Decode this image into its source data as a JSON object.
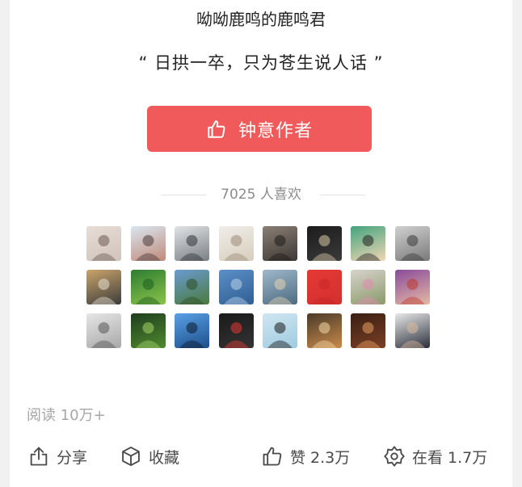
{
  "author_name": "呦呦鹿鸣的鹿鸣君",
  "motto": "“ 日拱一卒，只为苍生说人话 ”",
  "favorite_button": {
    "label": "钟意作者"
  },
  "likes": {
    "count_text": "7025 人喜欢"
  },
  "avatars": [
    {
      "icon": "cat-photo",
      "c1": "#e8ddd6",
      "c2": "#cfc3bb",
      "accent": "#6b5a52"
    },
    {
      "icon": "person-photo",
      "c1": "#d9e6f0",
      "c2": "#c18a7a",
      "accent": "#4a3a3a"
    },
    {
      "icon": "landscape-photo",
      "c1": "#e1e4e6",
      "c2": "#7a7f84",
      "accent": "#2f3336"
    },
    {
      "icon": "figure-photo",
      "c1": "#f0eee9",
      "c2": "#d8cdbd",
      "accent": "#9c8b78"
    },
    {
      "icon": "dark-photo",
      "c1": "#8a7f75",
      "c2": "#3d3833",
      "accent": "#1e1b19"
    },
    {
      "icon": "piano-photo",
      "c1": "#1c1c1c",
      "c2": "#3a3a3a",
      "accent": "#d9c9a8"
    },
    {
      "icon": "cartoon-avatar",
      "c1": "#43a37d",
      "c2": "#f2d6b5",
      "accent": "#222222"
    },
    {
      "icon": "bw-photo",
      "c1": "#d0d0d0",
      "c2": "#7a7a7a",
      "accent": "#3a3a3a"
    },
    {
      "icon": "person-photo",
      "c1": "#caa46a",
      "c2": "#3c3c3c",
      "accent": "#e8e0d0"
    },
    {
      "icon": "bamboo-photo",
      "c1": "#2e7d32",
      "c2": "#8bc34a",
      "accent": "#1b5e20"
    },
    {
      "icon": "trees-photo",
      "c1": "#6a9bd1",
      "c2": "#4a7a3c",
      "accent": "#2e4d24"
    },
    {
      "icon": "sea-photo",
      "c1": "#5b8fc7",
      "c2": "#2f5f94",
      "accent": "#bcd3ea"
    },
    {
      "icon": "sky-photo",
      "c1": "#9fb7c9",
      "c2": "#4d6b82",
      "accent": "#e2d3b0"
    },
    {
      "icon": "red-square",
      "c1": "#e53935",
      "c2": "#d32f2f",
      "accent": "#c62828"
    },
    {
      "icon": "lily-photo",
      "c1": "#d7d3cc",
      "c2": "#8a9a6a",
      "accent": "#e08bb0"
    },
    {
      "icon": "person-photo",
      "c1": "#8a4b9a",
      "c2": "#e3b9a5",
      "accent": "#c0392b"
    },
    {
      "icon": "sketch-photo",
      "c1": "#e6e6e6",
      "c2": "#a8a8a8",
      "accent": "#555555"
    },
    {
      "icon": "plants-photo",
      "c1": "#1f3d1f",
      "c2": "#4f8a2e",
      "accent": "#a5d36a"
    },
    {
      "icon": "silhouette-photo",
      "c1": "#5aa0e6",
      "c2": "#1d4f8a",
      "accent": "#0b1b2e"
    },
    {
      "icon": "kumamon-avatar",
      "c1": "#1a1a1a",
      "c2": "#333333",
      "accent": "#e53935"
    },
    {
      "icon": "exclamation-avatar",
      "c1": "#cfe6f2",
      "c2": "#9fcbe0",
      "accent": "#1a1a1a"
    },
    {
      "icon": "sunset-photo",
      "c1": "#4a3a2a",
      "c2": "#c98a4a",
      "accent": "#f3d9a6"
    },
    {
      "icon": "lights-photo",
      "c1": "#3a1f14",
      "c2": "#7a3f24",
      "accent": "#e8a060"
    },
    {
      "icon": "man-suit-photo",
      "c1": "#e9e9e9",
      "c2": "#2a2f3a",
      "accent": "#d9b9a0"
    }
  ],
  "read": {
    "label": "阅读 10万+"
  },
  "actions": {
    "share": "分享",
    "collect": "收藏",
    "like": "赞 2.3万",
    "wow": "在看 1.7万"
  },
  "colors": {
    "accent": "#f05a5a",
    "text": "#222222",
    "muted": "#8c8c8c"
  }
}
